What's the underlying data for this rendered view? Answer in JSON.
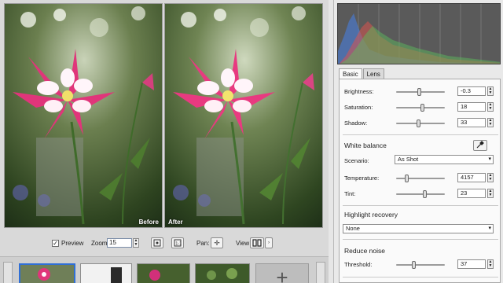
{
  "preview": {
    "before_label": "Before",
    "after_label": "After"
  },
  "toolbar": {
    "preview_label": "Preview",
    "preview_checked": true,
    "zoom_label": "Zoom:",
    "zoom_value": "15",
    "pan_label": "Pan:",
    "view_label": "View:"
  },
  "tabs": [
    {
      "label": "Basic",
      "active": true
    },
    {
      "label": "Lens",
      "active": false
    }
  ],
  "basic": {
    "brightness": {
      "label": "Brightness:",
      "value": "-0.3",
      "level": 0.47
    },
    "saturation": {
      "label": "Saturation:",
      "value": "18",
      "level": 0.55
    },
    "shadow": {
      "label": "Shadow:",
      "value": "33",
      "level": 0.45
    },
    "white_balance": {
      "title": "White balance",
      "scenario_label": "Scenario:",
      "scenario_value": "As Shot",
      "temperature": {
        "label": "Temperature:",
        "value": "4157",
        "level": 0.2
      },
      "tint": {
        "label": "Tint:",
        "value": "23",
        "level": 0.6
      }
    },
    "highlight_recovery": {
      "title": "Highlight recovery",
      "value": "None"
    },
    "reduce_noise": {
      "title": "Reduce noise",
      "threshold": {
        "label": "Threshold:",
        "value": "37",
        "level": 0.35
      }
    }
  },
  "icons": {
    "histogram": "histogram",
    "eyedropper": "eyedropper-icon",
    "pan": "move-icon",
    "view": "split-view-icon",
    "add": "plus-icon"
  },
  "colors": {
    "accent": "#2f6fd6",
    "histogram_bg": "#5a5a5a",
    "hist_red": "#d9534f",
    "hist_green": "#5cb85c",
    "hist_blue": "#4a78c9"
  }
}
